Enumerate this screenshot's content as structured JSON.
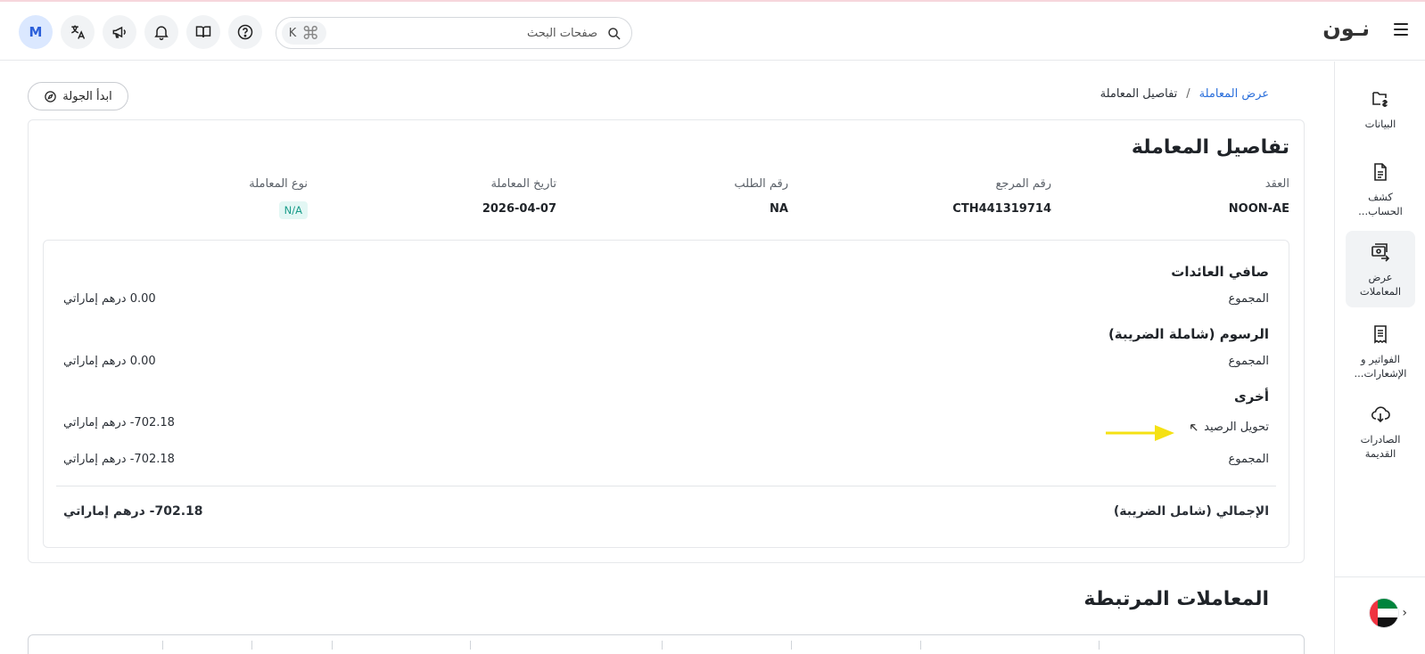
{
  "header": {
    "logo": "نـون",
    "search": {
      "placeholder": "صفحات البحث",
      "shortcut_key": "K",
      "shortcut_mod": "⌘"
    },
    "avatar_initial": "M"
  },
  "sidebar": {
    "items": [
      {
        "label": "البيانات",
        "icon": "data-icon",
        "active": false
      },
      {
        "label": "كشف الحساب...",
        "icon": "statement-icon",
        "active": false
      },
      {
        "label": "عرض المعاملات",
        "icon": "transactions-icon",
        "active": true
      },
      {
        "label": "الفواتير و الإشعارات...",
        "icon": "invoice-icon",
        "active": false
      },
      {
        "label": "الصادرات القديمة",
        "icon": "cloud-download-icon",
        "active": false
      }
    ]
  },
  "breadcrumb": {
    "parent": "عرض المعاملة",
    "separator": "/",
    "current": "تفاصيل المعاملة"
  },
  "tour_button": "ابدأ الجولة",
  "details": {
    "title": "تفاصيل المعاملة",
    "fields": [
      {
        "label": "العقد",
        "value": "NOON-AE"
      },
      {
        "label": "رقم المرجع",
        "value": "CTH441319714"
      },
      {
        "label": "رقم الطلب",
        "value": "NA"
      },
      {
        "label": "تاريخ المعاملة",
        "value": "2026-04-07"
      },
      {
        "label": "نوع المعاملة",
        "value": "N/A"
      }
    ],
    "sections": {
      "net_revenue": {
        "title": "صافي العائدات",
        "total_label": "المجموع",
        "total_value": "0.00  درهم إماراتي"
      },
      "fees": {
        "title": "الرسوم (شاملة الضريبة)",
        "total_label": "المجموع",
        "total_value": "0.00  درهم إماراتي"
      },
      "other": {
        "title": "أخرى",
        "row_label": "تحويل الرصيد",
        "row_value": "702.18-  درهم إماراتي",
        "total_label": "المجموع",
        "total_value": "702.18-  درهم إماراتي"
      }
    },
    "grand_total": {
      "label": "الإجمالي (شامل الضريبة)",
      "value": "702.18-  درهم إماراتي"
    }
  },
  "related": {
    "title": "المعاملات المرتبطة"
  },
  "colors": {
    "accent_link": "#2b6fdb",
    "badge_text": "#1a9c8a",
    "badge_bg": "#e3f7f4",
    "arrow": "#f5e113"
  }
}
